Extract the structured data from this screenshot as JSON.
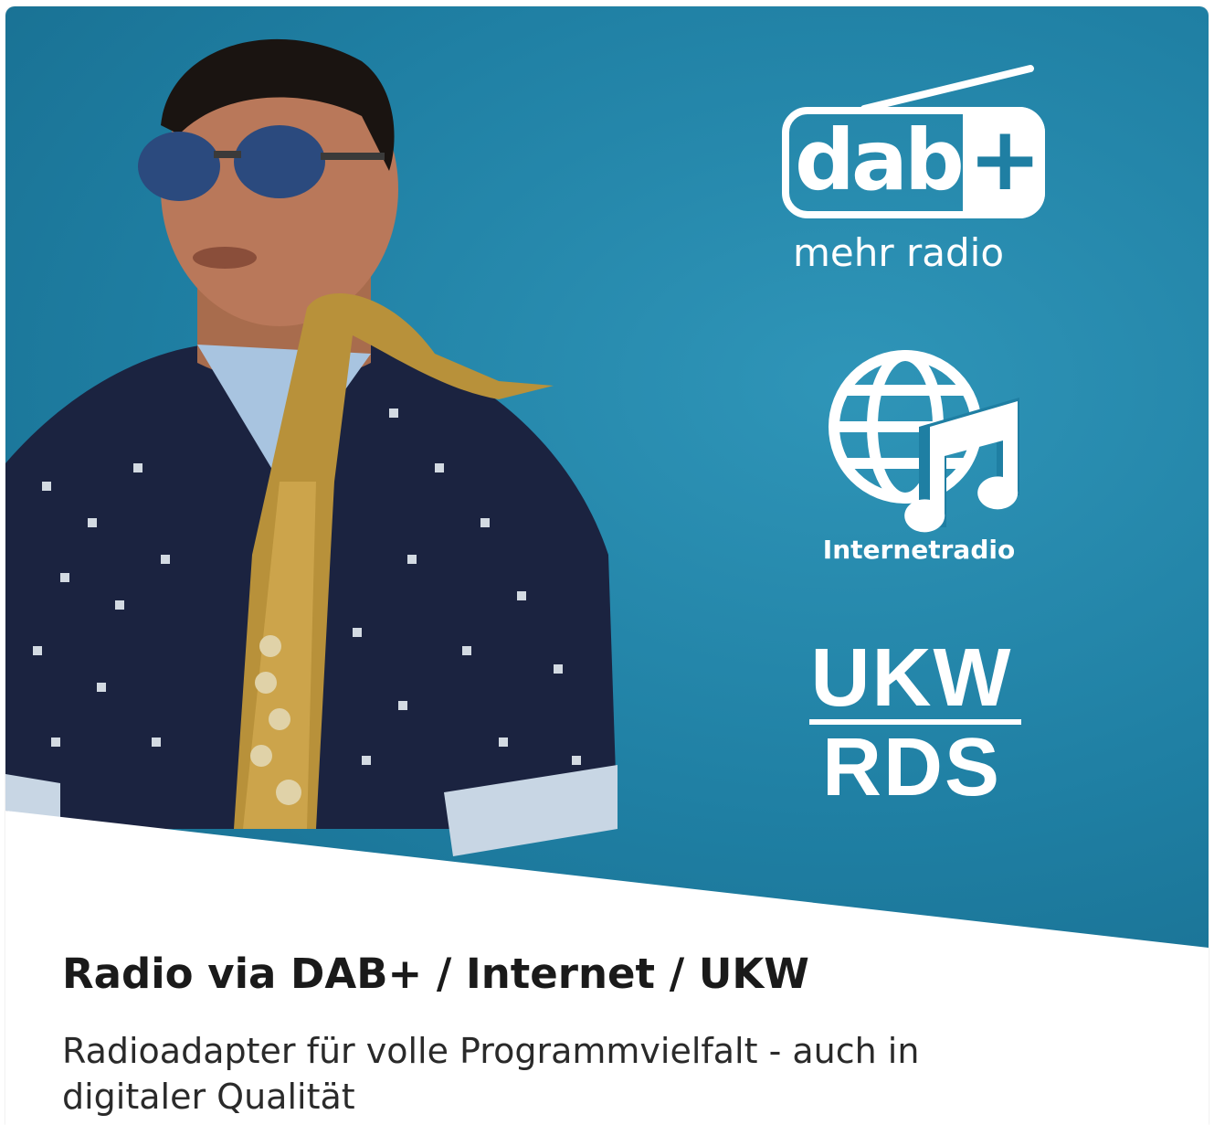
{
  "logos": {
    "dab": {
      "main": "dab",
      "plus": "+",
      "tagline": "mehr radio"
    },
    "internetradio": {
      "label": "Internetradio"
    },
    "ukw": {
      "top": "UKW",
      "bottom": "RDS"
    }
  },
  "caption": {
    "title": "Radio via DAB+ / Internet / UKW",
    "subtitle": "Radioadapter für volle Programmvielfalt - auch in digitaler Qualität"
  },
  "colors": {
    "background_blue": "#1f7fa3",
    "text_dark": "#1a1a1a",
    "logo_white": "#ffffff"
  }
}
